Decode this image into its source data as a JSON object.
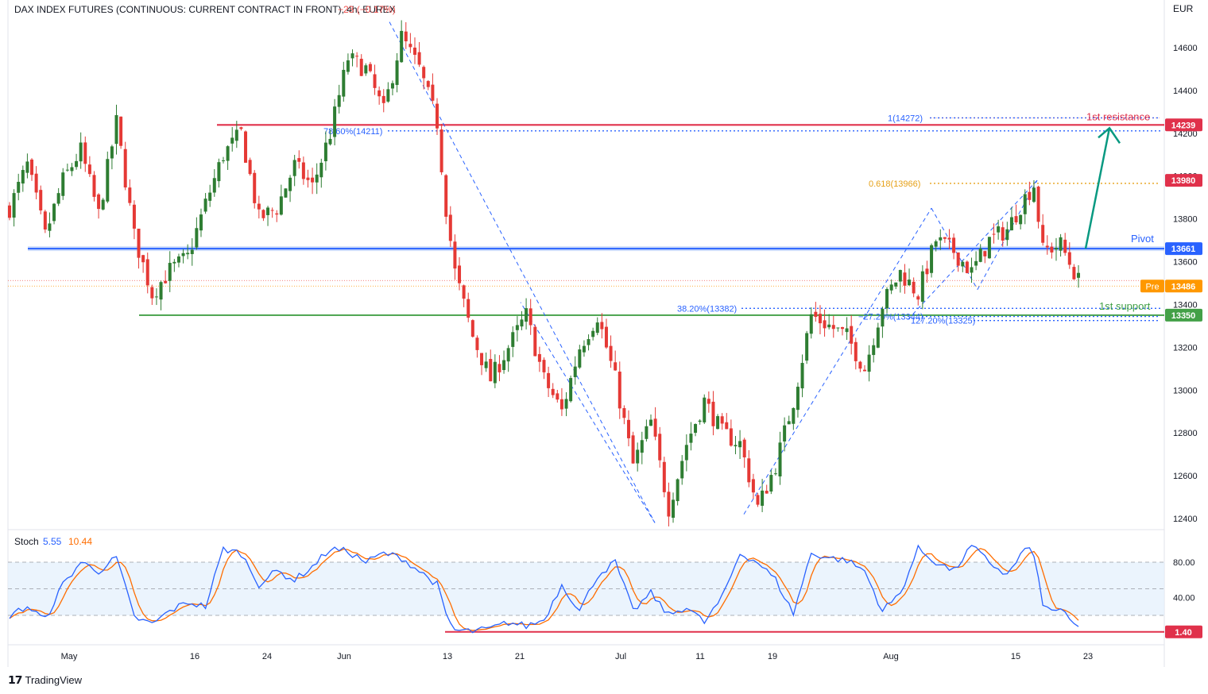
{
  "header": {
    "title": "DAX INDEX FUTURES (CONTINUOUS: CURRENT CONTRACT IN FRONT), 4h, EUREX",
    "change": "−23 (−0.17%)"
  },
  "currency": "EUR",
  "brand": "TradingView",
  "colors": {
    "up": "#26a69a",
    "down": "#ef5350",
    "upBody": "#2e7d32",
    "downBody": "#e53935",
    "resistance": "#e0314b",
    "pivot": "#2962ff",
    "support": "#43a047",
    "fib": "#2962ff",
    "fibGold": "#e6a118",
    "arrow": "#089981",
    "stochK": "#2962ff",
    "stochD": "#ff6d00",
    "stochBand": "#e3effc"
  },
  "chart_data": [
    {
      "type": "candlestick",
      "title": "DAX INDEX FUTURES (CONTINUOUS: CURRENT CONTRACT IN FRONT), 4h, EUREX",
      "x_tick_labels": [
        "May",
        "16",
        "24",
        "Jun",
        "13",
        "21",
        "Jul",
        "11",
        "19",
        "Aug",
        "15",
        "23"
      ],
      "y_tick_labels": [
        "14600",
        "14400",
        "14200",
        "14000",
        "13800",
        "13600",
        "13400",
        "13200",
        "13000",
        "12800",
        "12600",
        "12400"
      ],
      "ylim": [
        12370,
        14780
      ],
      "close_path": [
        [
          0,
          13850
        ],
        [
          4,
          14050
        ],
        [
          8,
          13720
        ],
        [
          12,
          13980
        ],
        [
          16,
          14120
        ],
        [
          20,
          13820
        ],
        [
          24,
          14250
        ],
        [
          28,
          13720
        ],
        [
          32,
          13450
        ],
        [
          36,
          13560
        ],
        [
          40,
          13620
        ],
        [
          44,
          13870
        ],
        [
          48,
          14100
        ],
        [
          52,
          14200
        ],
        [
          56,
          13800
        ],
        [
          60,
          13850
        ],
        [
          64,
          14050
        ],
        [
          68,
          13950
        ],
        [
          72,
          14200
        ],
        [
          76,
          14550
        ],
        [
          80,
          14500
        ],
        [
          84,
          14300
        ],
        [
          88,
          14650
        ],
        [
          92,
          14500
        ],
        [
          96,
          14250
        ],
        [
          98,
          13850
        ],
        [
          100,
          13550
        ],
        [
          104,
          13250
        ],
        [
          108,
          13050
        ],
        [
          112,
          13200
        ],
        [
          116,
          13350
        ],
        [
          120,
          13050
        ],
        [
          124,
          12900
        ],
        [
          128,
          13200
        ],
        [
          132,
          13350
        ],
        [
          136,
          13050
        ],
        [
          140,
          12650
        ],
        [
          144,
          12850
        ],
        [
          148,
          12450
        ],
        [
          152,
          12750
        ],
        [
          156,
          12950
        ],
        [
          160,
          12800
        ],
        [
          164,
          12750
        ],
        [
          168,
          12450
        ],
        [
          172,
          12650
        ],
        [
          176,
          12950
        ],
        [
          180,
          13350
        ],
        [
          184,
          13300
        ],
        [
          188,
          13250
        ],
        [
          192,
          13100
        ],
        [
          196,
          13400
        ],
        [
          200,
          13550
        ],
        [
          204,
          13450
        ],
        [
          208,
          13700
        ],
        [
          212,
          13650
        ],
        [
          216,
          13550
        ],
        [
          220,
          13700
        ],
        [
          224,
          13750
        ],
        [
          228,
          13900
        ],
        [
          230,
          13960
        ],
        [
          232,
          13650
        ],
        [
          236,
          13680
        ],
        [
          240,
          13510
        ]
      ],
      "annotations": [
        {
          "label": "1st resistance",
          "value": 14239
        },
        {
          "label": "Pivot",
          "value": 13661
        },
        {
          "label": "1st support",
          "value": 13350
        }
      ],
      "fib_levels": [
        {
          "label": "1(14272)",
          "value": 14272
        },
        {
          "label": "78.60%(14211)",
          "value": 14211
        },
        {
          "label": "0.618(13966)",
          "value": 13966
        },
        {
          "label": "38.20%(13382)",
          "value": 13382
        },
        {
          "label": "−27.20%(13344)",
          "value": 13344
        },
        {
          "label": "127.20%(13325)",
          "value": 13325
        }
      ],
      "price_tags": [
        {
          "label": "14239",
          "value": 14239,
          "color": "#e0314b"
        },
        {
          "label": "13980",
          "value": 13980,
          "color": "#e0314b"
        },
        {
          "label": "13661",
          "value": 13661,
          "color": "#2962ff"
        },
        {
          "label": "13486",
          "value": 13486,
          "color": "#ff9800",
          "prefix": "Pre"
        },
        {
          "label": "13350",
          "value": 13350,
          "color": "#43a047"
        }
      ]
    },
    {
      "type": "line",
      "title": "Stoch",
      "series": [
        {
          "name": "5.55",
          "color": "#2962ff"
        },
        {
          "name": "10.44",
          "color": "#ff6d00"
        }
      ],
      "y_tick_labels": [
        "80.00",
        "40.00"
      ],
      "ylim": [
        -20,
        120
      ],
      "band": [
        20,
        80
      ],
      "last_value_tag": "1.40",
      "k_path": [
        [
          0,
          20
        ],
        [
          4,
          30
        ],
        [
          8,
          15
        ],
        [
          12,
          55
        ],
        [
          16,
          80
        ],
        [
          20,
          70
        ],
        [
          24,
          85
        ],
        [
          28,
          18
        ],
        [
          32,
          10
        ],
        [
          36,
          25
        ],
        [
          40,
          35
        ],
        [
          44,
          30
        ],
        [
          48,
          95
        ],
        [
          52,
          90
        ],
        [
          56,
          55
        ],
        [
          60,
          70
        ],
        [
          64,
          60
        ],
        [
          68,
          75
        ],
        [
          72,
          95
        ],
        [
          76,
          92
        ],
        [
          80,
          80
        ],
        [
          84,
          90
        ],
        [
          88,
          85
        ],
        [
          92,
          70
        ],
        [
          96,
          55
        ],
        [
          98,
          20
        ],
        [
          100,
          3
        ],
        [
          104,
          2
        ],
        [
          108,
          5
        ],
        [
          112,
          12
        ],
        [
          116,
          8
        ],
        [
          120,
          15
        ],
        [
          124,
          55
        ],
        [
          128,
          25
        ],
        [
          132,
          65
        ],
        [
          136,
          80
        ],
        [
          140,
          25
        ],
        [
          144,
          45
        ],
        [
          148,
          20
        ],
        [
          152,
          30
        ],
        [
          156,
          12
        ],
        [
          160,
          40
        ],
        [
          164,
          90
        ],
        [
          168,
          80
        ],
        [
          172,
          60
        ],
        [
          176,
          22
        ],
        [
          180,
          90
        ],
        [
          184,
          85
        ],
        [
          188,
          82
        ],
        [
          192,
          70
        ],
        [
          196,
          25
        ],
        [
          200,
          45
        ],
        [
          204,
          95
        ],
        [
          208,
          80
        ],
        [
          212,
          70
        ],
        [
          216,
          98
        ],
        [
          220,
          80
        ],
        [
          224,
          65
        ],
        [
          228,
          95
        ],
        [
          230,
          90
        ],
        [
          232,
          30
        ],
        [
          236,
          25
        ],
        [
          240,
          5
        ]
      ]
    }
  ]
}
